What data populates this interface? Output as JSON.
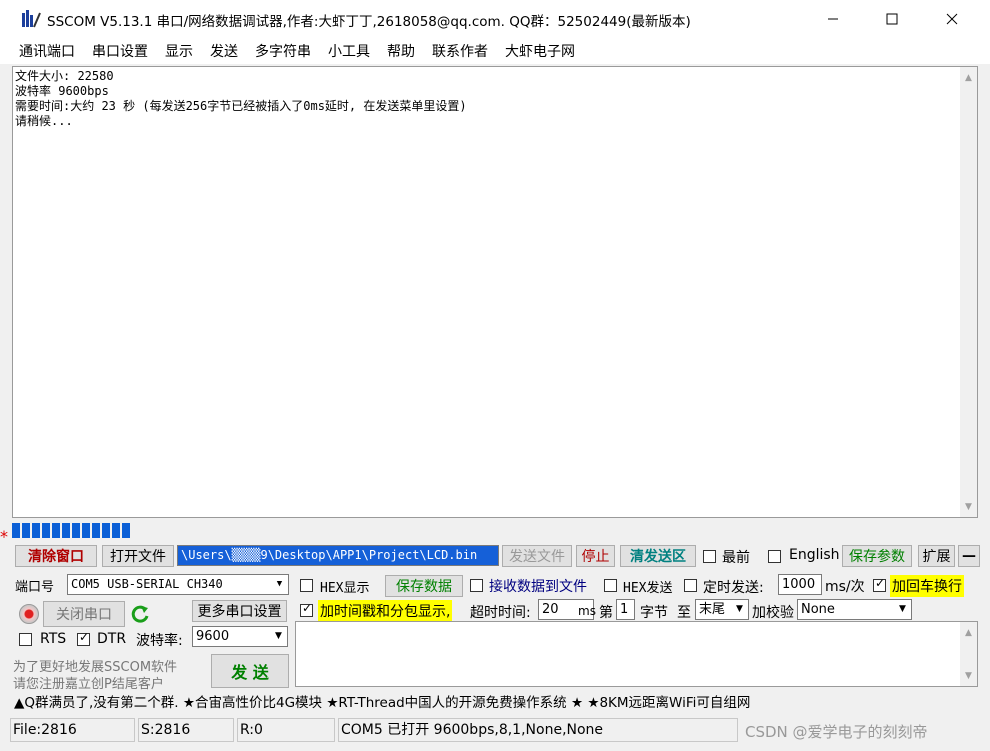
{
  "window": {
    "title": "SSCOM V5.13.1 串口/网络数据调试器,作者:大虾丁丁,2618058@qq.com. QQ群：52502449(最新版本)"
  },
  "menu": [
    "通讯端口",
    "串口设置",
    "显示",
    "发送",
    "多字符串",
    "小工具",
    "帮助",
    "联系作者",
    "大虾电子网"
  ],
  "output": {
    "lines": [
      "文件大小: 22580",
      "波特率 9600bps",
      "需要时间:大约 23 秒 (每发送256字节已经被插入了0ms延时, 在发送菜单里设置)",
      "请稍候..."
    ]
  },
  "progress": {
    "segments_filled": 12,
    "value": 0.5
  },
  "send_row": {
    "clear_window": "清除窗口",
    "open_file": "打开文件",
    "file_path": "\\Users\\▒▒▒▒9\\Desktop\\APP1\\Project\\LCD.bin",
    "send_file": "发送文件",
    "stop": "停止",
    "clear_send": "清发送区",
    "topmost": "最前",
    "english": "English",
    "save_params": "保存参数",
    "expand": "扩展",
    "collapse": "—"
  },
  "port": {
    "port_label": "端口号",
    "port_value": "COM5 USB-SERIAL CH340",
    "hex_display": "HEX显示",
    "save_data": "保存数据",
    "recv_to_file": "接收数据到文件",
    "hex_send": "HEX发送",
    "timed_send": "定时发送:",
    "interval": "1000",
    "interval_unit": "ms/次",
    "add_crlf": "加回车换行",
    "close_port": "关闭串口",
    "more_settings": "更多串口设置",
    "timestamp": "加时间戳和分包显示,",
    "timeout_label": "超时时间:",
    "timeout_value": "20",
    "timeout_unit": "ms",
    "nth_label": "第",
    "nth_value": "1",
    "byte_label": "字节",
    "to_label": "至",
    "end_value": "末尾",
    "checksum_label": "加校验",
    "checksum_value": "None",
    "rts": "RTS",
    "dtr": "DTR",
    "baud_label": "波特率:",
    "baud_value": "9600",
    "promo_line1": "为了更好地发展SSCOM软件",
    "promo_line2": "请您注册嘉立创P结尾客户",
    "send": "发 送"
  },
  "marquee": "▲Q群满员了,没有第二个群. ★合宙高性价比4G模块 ★RT-Thread中国人的开源免费操作系统 ★ ★8KM远距离WiFi可自组网",
  "status": {
    "file": "File:2816",
    "sent": "S:2816",
    "recv": "R:0",
    "port_state": "COM5 已打开  9600bps,8,1,None,None"
  },
  "watermark": "CSDN @爱学电子的刻刻帝",
  "colors": {
    "progress": "#0b5fd6",
    "highlight": "#ffff00",
    "red_text": "#b00000",
    "green_text": "#008000"
  }
}
